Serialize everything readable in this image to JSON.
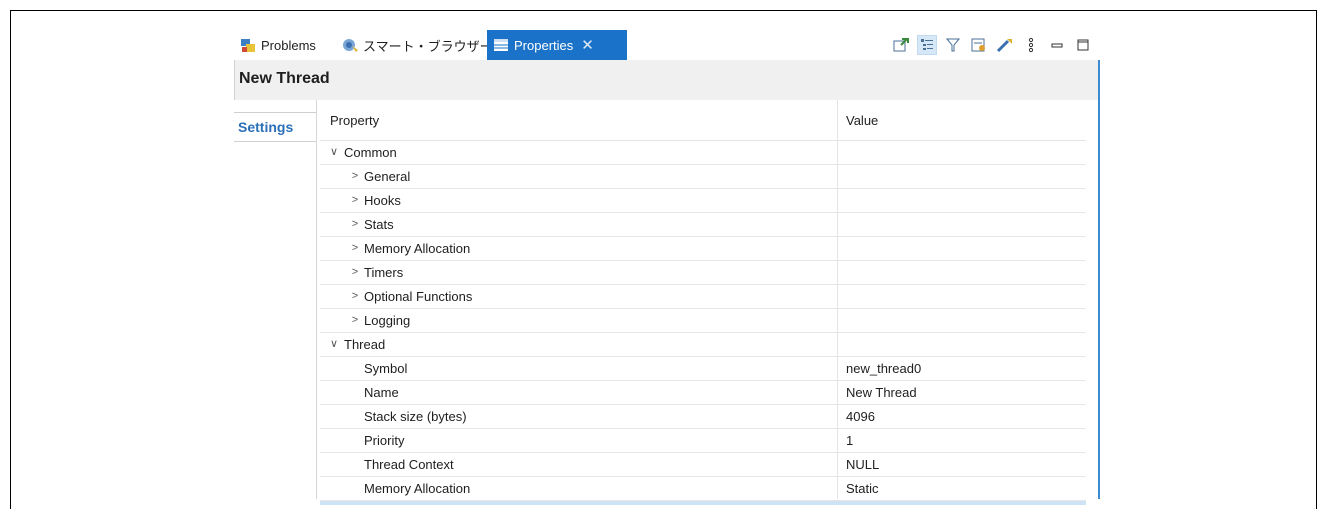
{
  "tabs": {
    "problems": "Problems",
    "smart_browser": "スマート・ブラウザー",
    "properties": "Properties"
  },
  "toolbar_icons": [
    "pin-editor-icon",
    "show-categories-icon",
    "filter-icon",
    "show-advanced-icon",
    "restore-default-icon",
    "view-menu-icon",
    "minimize-icon",
    "maximize-icon"
  ],
  "header": {
    "title": "New Thread"
  },
  "side_tabs": {
    "settings": "Settings"
  },
  "grid": {
    "col_property": "Property",
    "col_value": "Value",
    "common": {
      "label": "Common",
      "children": [
        "General",
        "Hooks",
        "Stats",
        "Memory Allocation",
        "Timers",
        "Optional Functions",
        "Logging"
      ]
    },
    "thread": {
      "label": "Thread",
      "rows": [
        {
          "label": "Symbol",
          "value": "new_thread0"
        },
        {
          "label": "Name",
          "value": "New Thread"
        },
        {
          "label": "Stack size (bytes)",
          "value": "4096"
        },
        {
          "label": "Priority",
          "value": "1"
        },
        {
          "label": "Thread Context",
          "value": "NULL"
        },
        {
          "label": "Memory Allocation",
          "value": "Static"
        }
      ]
    }
  },
  "colors": {
    "accent": "#1a73c8",
    "settings_text": "#2a6fb8",
    "border_active": "#3d8ad1"
  }
}
